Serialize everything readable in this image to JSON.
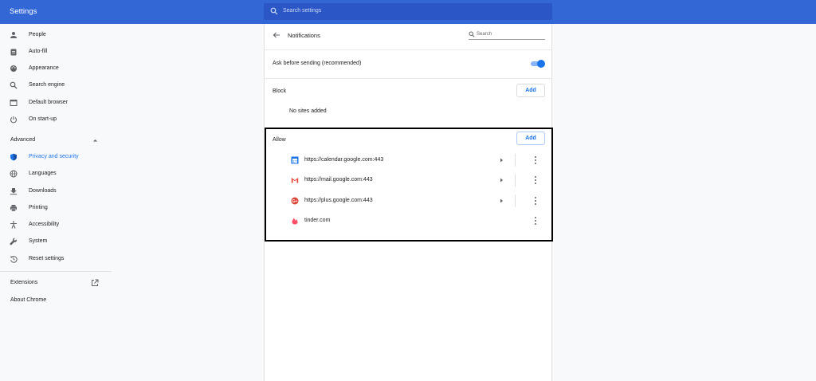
{
  "app": {
    "title": "Settings"
  },
  "search": {
    "placeholder": "Search settings"
  },
  "sidebar": {
    "items": [
      {
        "label": "People",
        "icon": "person-icon"
      },
      {
        "label": "Auto-fill",
        "icon": "clipboard-icon"
      },
      {
        "label": "Appearance",
        "icon": "palette-icon"
      },
      {
        "label": "Search engine",
        "icon": "search-icon"
      },
      {
        "label": "Default browser",
        "icon": "browser-icon"
      },
      {
        "label": "On start-up",
        "icon": "power-icon"
      }
    ],
    "advanced_label": "Advanced",
    "advanced_items": [
      {
        "label": "Privacy and security",
        "icon": "shield-icon",
        "active": true
      },
      {
        "label": "Languages",
        "icon": "globe-icon"
      },
      {
        "label": "Downloads",
        "icon": "download-icon"
      },
      {
        "label": "Printing",
        "icon": "printer-icon"
      },
      {
        "label": "Accessibility",
        "icon": "accessibility-icon"
      },
      {
        "label": "System",
        "icon": "wrench-icon"
      },
      {
        "label": "Reset settings",
        "icon": "restore-icon"
      }
    ],
    "extensions_label": "Extensions",
    "about_label": "About Chrome"
  },
  "notifications": {
    "title": "Notifications",
    "search_placeholder": "Search",
    "ask_label": "Ask before sending (recommended)",
    "ask_enabled": true,
    "block": {
      "heading": "Block",
      "add_label": "Add",
      "empty_text": "No sites added"
    },
    "allow": {
      "heading": "Allow",
      "add_label": "Add",
      "sites": [
        {
          "url": "https://calendar.google.com:443",
          "favicon": "calendar-favicon",
          "has_arrow": true
        },
        {
          "url": "https://mail.google.com:443",
          "favicon": "gmail-favicon",
          "has_arrow": true
        },
        {
          "url": "https://plus.google.com:443",
          "favicon": "google-plus-favicon",
          "has_arrow": true
        },
        {
          "url": "tinder.com",
          "favicon": "tinder-favicon",
          "has_arrow": false
        }
      ]
    }
  },
  "colors": {
    "accent": "#1a73e8",
    "header": "#3367d6",
    "header_search": "#2a56c6"
  }
}
